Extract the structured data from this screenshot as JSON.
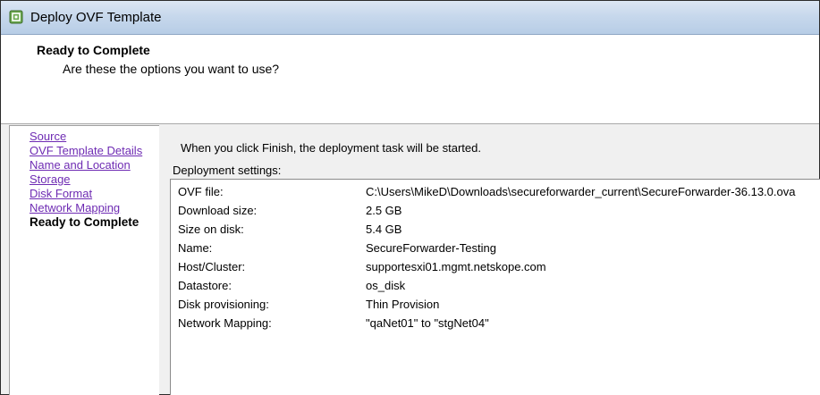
{
  "window": {
    "title": "Deploy OVF Template",
    "icon": "vsphere-app-icon"
  },
  "header": {
    "title": "Ready to Complete",
    "subtitle": "Are these the options you want to use?"
  },
  "nav": {
    "items": [
      {
        "label": "Source",
        "state": "visited"
      },
      {
        "label": "OVF Template Details",
        "state": "visited"
      },
      {
        "label": "Name and Location",
        "state": "visited"
      },
      {
        "label": "Storage",
        "state": "visited"
      },
      {
        "label": "Disk Format",
        "state": "visited"
      },
      {
        "label": "Network Mapping",
        "state": "visited"
      },
      {
        "label": "Ready to Complete",
        "state": "current"
      }
    ]
  },
  "main": {
    "intro": "When you click Finish, the deployment task will be started.",
    "settings_label": "Deployment settings:",
    "settings": [
      {
        "key": "OVF file:",
        "value": "C:\\Users\\MikeD\\Downloads\\secureforwarder_current\\SecureForwarder-36.13.0.ova"
      },
      {
        "key": "Download size:",
        "value": "2.5 GB"
      },
      {
        "key": "Size on disk:",
        "value": "5.4 GB"
      },
      {
        "key": "Name:",
        "value": "SecureForwarder-Testing"
      },
      {
        "key": "Host/Cluster:",
        "value": "supportesxi01.mgmt.netskope.com"
      },
      {
        "key": "Datastore:",
        "value": "os_disk"
      },
      {
        "key": "Disk provisioning:",
        "value": "Thin Provision"
      },
      {
        "key": "Network Mapping:",
        "value": "\"qaNet01\" to \"stgNet04\""
      }
    ]
  },
  "colors": {
    "visited_link": "#6e2bb3",
    "titlebar": "#c7d8ec",
    "panel_bg": "#f0f0f0"
  }
}
